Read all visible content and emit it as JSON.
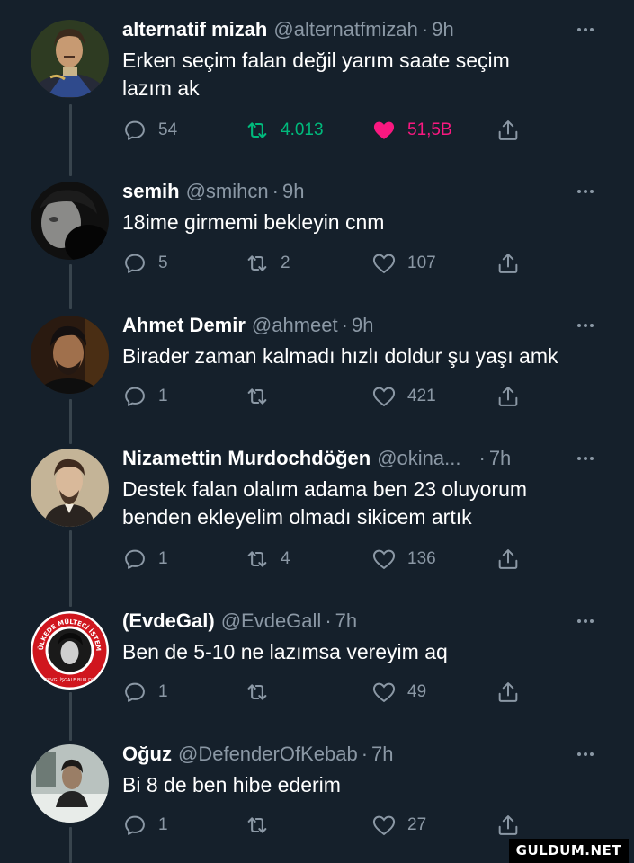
{
  "tweets": [
    {
      "name": "alternatif mizah",
      "handle": "@alternatfmizah",
      "separator": "·",
      "time": "9h",
      "text": "Erken seçim falan değil yarım saate seçim lazım ak",
      "replies": "54",
      "retweets": "4.013",
      "likes": "51,5B",
      "liked": true,
      "retweeted": true,
      "avatar": "painting-portrait-avatar"
    },
    {
      "name": "semih",
      "handle": "@smihcn",
      "separator": "·",
      "time": "9h",
      "text": "18ime girmemi bekleyin cnm",
      "replies": "5",
      "retweets": "2",
      "likes": "107",
      "liked": false,
      "retweeted": false,
      "avatar": "dark-selfie-avatar"
    },
    {
      "name": "Ahmet Demir",
      "handle": "@ahmeet",
      "separator": "·",
      "time": "9h",
      "text": "Birader zaman kalmadı hızlı doldur şu yaşı amk",
      "replies": "1",
      "retweets": "",
      "likes": "421",
      "liked": false,
      "retweeted": false,
      "avatar": "man-portrait-avatar"
    },
    {
      "name": "Nizamettin Murdochdöğen",
      "handle": "@okina...",
      "separator": "·",
      "time": "7h",
      "text": "Destek falan olalım adama ben 23 oluyorum benden ekleyelim olmadı sikicem artık",
      "replies": "1",
      "retweets": "4",
      "likes": "136",
      "liked": false,
      "retweeted": false,
      "avatar": "chekhov-portrait-avatar"
    },
    {
      "name": "(EvdeGal)",
      "handle": "@EvdeGall",
      "separator": "·",
      "time": "7h",
      "text": "Ben de 5-10 ne lazımsa vereyim aq",
      "replies": "1",
      "retweets": "",
      "likes": "49",
      "liked": false,
      "retweeted": false,
      "avatar": "red-badge-avatar",
      "avatar_ring_text": "ÜLKEDE MÜLTECİ İSTEMİYORUM",
      "avatar_bottom_text": "SEVGİ İŞGALE BUR DE"
    },
    {
      "name": "Oğuz",
      "handle": "@DefenderOfKebab",
      "separator": "·",
      "time": "7h",
      "text": "Bi 8 de ben hibe ederim",
      "replies": "1",
      "retweets": "",
      "likes": "27",
      "liked": false,
      "retweeted": false,
      "avatar": "man-indoor-avatar"
    }
  ],
  "colors": {
    "background": "#15202b",
    "text": "#ffffff",
    "muted": "#8b98a5",
    "like_active": "#f91880",
    "retweet_active": "#00ba7c",
    "thread_line": "#38444d"
  },
  "watermark": "GULDUM.NET"
}
